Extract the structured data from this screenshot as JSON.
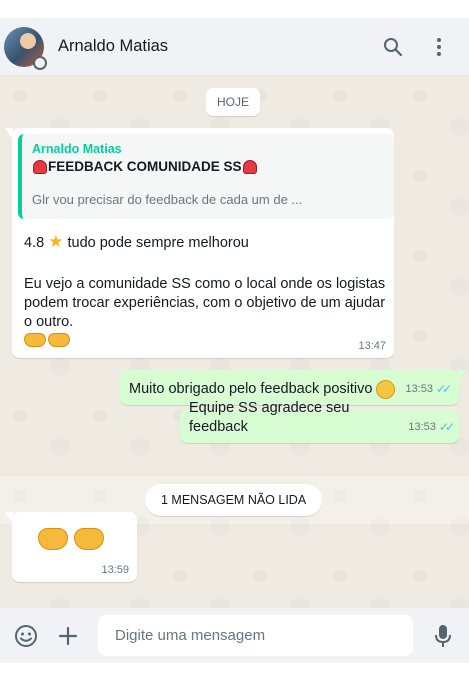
{
  "header": {
    "contact_name": "Arnaldo Matias",
    "icons": [
      "avatar",
      "search-icon",
      "menu-dots-icon"
    ]
  },
  "chat": {
    "date_label": "HOJE",
    "messages": [
      {
        "direction": "in",
        "quote": {
          "author": "Arnaldo Matias",
          "title": "FEEDBACK COMUNIDADE SS",
          "text": "Glr vou precisar do feedback de cada um de ..."
        },
        "line1_prefix": "4.8",
        "line1_suffix": "tudo pode sempre melhorou",
        "body": "Eu vejo a comunidade SS como o local onde os logistas podem trocar experiências, com o objetivo de um ajudar o outro.",
        "time": "13:47"
      },
      {
        "direction": "out",
        "text": "Muito obrigado pelo feedback positivo",
        "time": "13:53"
      },
      {
        "direction": "out",
        "text": "Equipe SS agradece seu feedback",
        "time": "13:53"
      },
      {
        "direction": "in",
        "time": "13:59"
      }
    ],
    "unread_label": "1 MENSAGEM NÃO LIDA"
  },
  "composer": {
    "placeholder": "Digite uma mensagem",
    "icons": [
      "emoji-icon",
      "plus-icon",
      "microphone-icon"
    ]
  },
  "colors": {
    "outgoing_bubble": "#d9fdd3",
    "incoming_bubble": "#ffffff",
    "accent_green": "#06cf9c",
    "read_ticks": "#53bdeb",
    "chat_background": "#efeae2"
  }
}
